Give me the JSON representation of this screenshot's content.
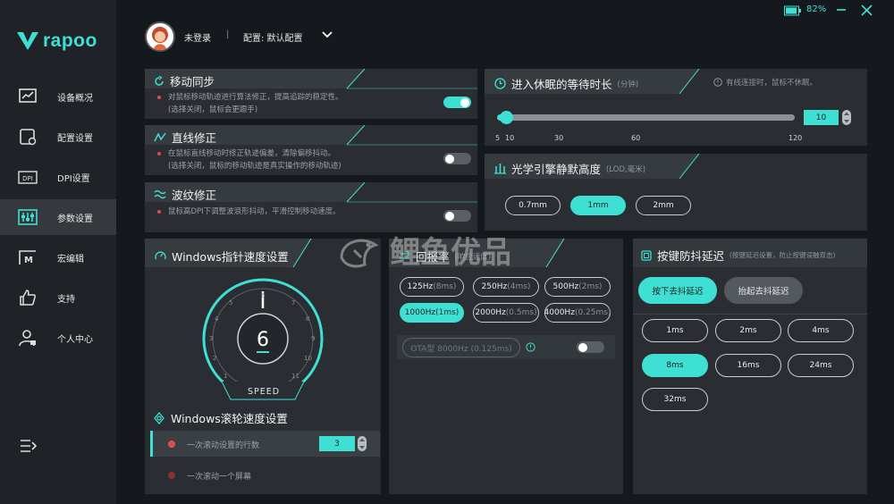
{
  "app": {
    "brand": "rapoo",
    "battery": "82%"
  },
  "sidebar": {
    "items": [
      {
        "label": "设备概况",
        "icon": "chart-line-icon"
      },
      {
        "label": "配置设置",
        "icon": "config-icon"
      },
      {
        "label": "DPI设置",
        "icon": "dpi-icon"
      },
      {
        "label": "参数设置",
        "icon": "sliders-icon"
      },
      {
        "label": "宏编辑",
        "icon": "macro-icon"
      },
      {
        "label": "支持",
        "icon": "thumbs-up-icon"
      },
      {
        "label": "个人中心",
        "icon": "user-icon"
      }
    ]
  },
  "header": {
    "login": "未登录",
    "config": "配置: 默认配置"
  },
  "move_sync": {
    "title": "移动同步",
    "desc1": "对鼠标移动轨迹进行算法修正，提高追踪的稳定性。",
    "desc2": "(选择关闭，鼠标会更跟手)",
    "enabled": true
  },
  "line_fix": {
    "title": "直线修正",
    "desc1": "在鼠标直线移动时修正轨迹偏差，清除偏移抖动。",
    "desc2": "(选择关闭，鼠标的移动轨迹是真实操作的移动轨迹)",
    "enabled": false
  },
  "ripple_fix": {
    "title": "波纹修正",
    "desc1": "鼠标高DPI下调整波浪形抖动，平滑控制移动速度。",
    "enabled": false
  },
  "sleep": {
    "title": "进入休眠的等待时长",
    "unit": "(分钟)",
    "hint": "有线连接时，鼠标不休眠。",
    "value": "10",
    "ticks": [
      "5",
      "10",
      "30",
      "60",
      "120"
    ]
  },
  "lod": {
    "title": "光学引擎静默高度",
    "unit": "(LOD,毫米)",
    "options": [
      "0.7mm",
      "1mm",
      "2mm"
    ],
    "selected": "1mm"
  },
  "pointer": {
    "title": "Windows指针速度设置",
    "value": "6",
    "speed_label": "SPEED",
    "dial_numbers": [
      "1",
      "2",
      "3",
      "4",
      "5",
      "6",
      "7",
      "8",
      "9",
      "10",
      "11"
    ]
  },
  "scroll": {
    "title": "Windows滚轮速度设置",
    "opt1": "一次滚动设置的行数",
    "opt1_value": "3",
    "opt2": "一次滚动一个屏幕"
  },
  "report": {
    "title": "回报率",
    "subtitle": "(响应速度)",
    "rates": [
      {
        "main": "125Hz",
        "sub": "(8ms)"
      },
      {
        "main": "250Hz",
        "sub": "(4ms)"
      },
      {
        "main": "500Hz",
        "sub": "(2ms)"
      },
      {
        "main": "1000Hz",
        "sub": "(1ms)"
      },
      {
        "main": "2000Hz",
        "sub": "(0.5ms)"
      },
      {
        "main": "4000Hz",
        "sub": "(0.25ms)"
      }
    ],
    "selected": "1000Hz",
    "ota_label": "OTA型 8000Hz (0.125ms)",
    "ota_enabled": false
  },
  "debounce": {
    "title": "按键防抖延迟",
    "subtitle": "(按键延迟设置，防止按键误触双击)",
    "press": "按下去抖延迟",
    "release": "抬起去抖延迟",
    "options": [
      "1ms",
      "2ms",
      "4ms",
      "8ms",
      "16ms",
      "24ms",
      "32ms"
    ],
    "selected": "8ms"
  },
  "watermark": "鲤鱼优品",
  "colors": {
    "accent": "#3ee0d3",
    "panel": "#2a2e33",
    "bg": "#15181c",
    "red_dot": "#e34b52"
  }
}
